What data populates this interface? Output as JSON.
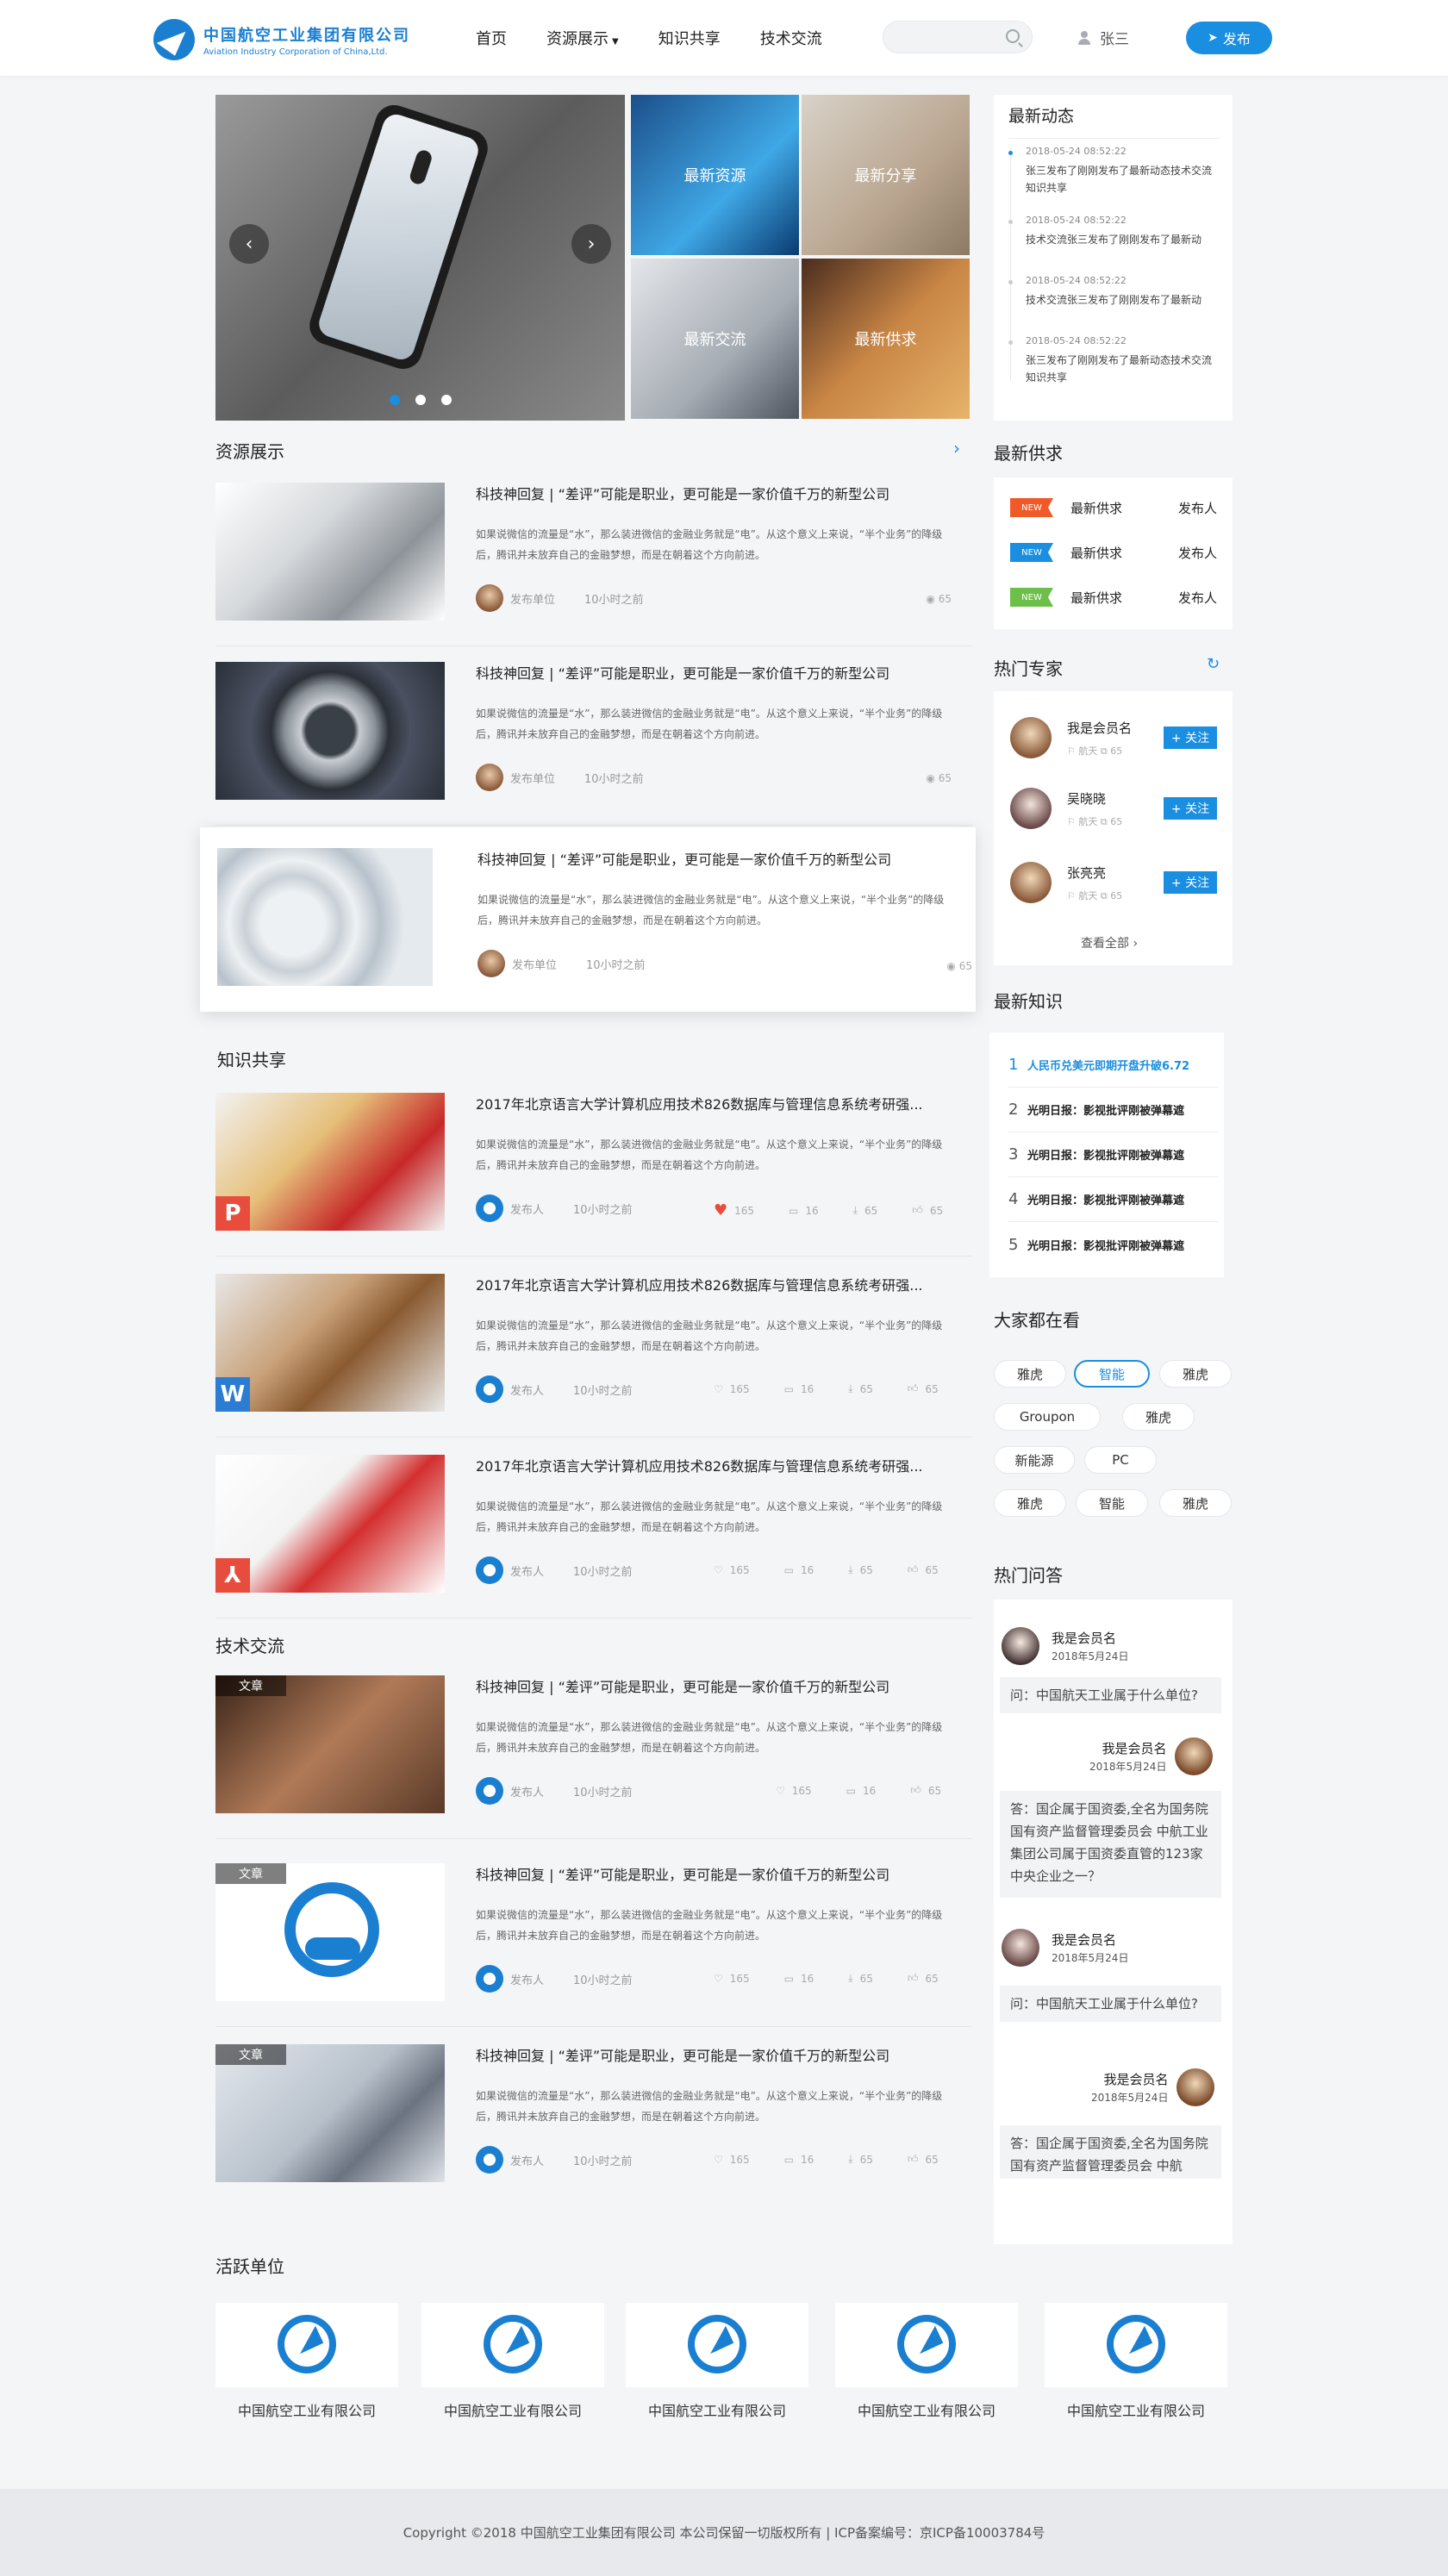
{
  "header": {
    "logo_cn": "中国航空工业集团有限公司",
    "logo_en": "Aviation Industry Corporation of China,Ltd.",
    "nav": [
      "首页",
      "资源展示",
      "知识共享",
      "技术交流"
    ],
    "search_placeholder": "",
    "username": "张三",
    "publish_label": "发布"
  },
  "banner": {
    "tiles": [
      "最新资源",
      "最新分享",
      "最新交流",
      "最新供求"
    ],
    "prev": "‹",
    "next": "›",
    "slides": 3,
    "active_slide": 1
  },
  "sections": {
    "resources": "资源展示",
    "knowledge": "知识共享",
    "tech": "技术交流",
    "units": "活跃单位"
  },
  "resources": [
    {
      "title": "科技神回复 | “差评”可能是职业，更可能是一家价值千万的新型公司",
      "desc": "如果说微信的流量是“水”，那么装进微信的金融业务就是“电”。从这个意义上来说，“半个业务”的降级后，腾讯并未放弃自己的金融梦想，而是在朝着这个方向前进。",
      "author": "发布单位",
      "time": "10小时之前",
      "views": "65"
    },
    {
      "title": "科技神回复 | “差评”可能是职业，更可能是一家价值千万的新型公司",
      "desc": "如果说微信的流量是“水”，那么装进微信的金融业务就是“电”。从这个意义上来说，“半个业务”的降级后，腾讯并未放弃自己的金融梦想，而是在朝着这个方向前进。",
      "author": "发布单位",
      "time": "10小时之前",
      "views": "65"
    },
    {
      "title": "科技神回复 | “差评”可能是职业，更可能是一家价值千万的新型公司",
      "desc": "如果说微信的流量是“水”，那么装进微信的金融业务就是“电”。从这个意义上来说，“半个业务”的降级后，腾讯并未放弃自己的金融梦想，而是在朝着这个方向前进。",
      "author": "发布单位",
      "time": "10小时之前",
      "views": "65"
    }
  ],
  "knowledge": [
    {
      "title": "2017年北京语言大学计算机应用技术826数据库与管理信息系统考研强...",
      "desc": "如果说微信的流量是“水”，那么装进微信的金融业务就是“电”。从这个意义上来说，“半个业务”的降级后，腾讯并未放弃自己的金融梦想，而是在朝着这个方向前进。",
      "author": "发布人",
      "time": "10小时之前",
      "likes": "165",
      "comments": "16",
      "downloads": "65",
      "thumbs": "65",
      "type": "P",
      "type_color": "#e84c3d"
    },
    {
      "title": "2017年北京语言大学计算机应用技术826数据库与管理信息系统考研强...",
      "desc": "如果说微信的流量是“水”，那么装进微信的金融业务就是“电”。从这个意义上来说，“半个业务”的降级后，腾讯并未放弃自己的金融梦想，而是在朝着这个方向前进。",
      "author": "发布人",
      "time": "10小时之前",
      "likes": "165",
      "comments": "16",
      "downloads": "65",
      "thumbs": "65",
      "type": "W",
      "type_color": "#2b7cd3"
    },
    {
      "title": "2017年北京语言大学计算机应用技术826数据库与管理信息系统考研强...",
      "desc": "如果说微信的流量是“水”，那么装进微信的金融业务就是“电”。从这个意义上来说，“半个业务”的降级后，腾讯并未放弃自己的金融梦想，而是在朝着这个方向前进。",
      "author": "发布人",
      "time": "10小时之前",
      "likes": "165",
      "comments": "16",
      "downloads": "65",
      "thumbs": "65",
      "type": "⅄",
      "type_color": "#e84c3d"
    }
  ],
  "tech": [
    {
      "tag": "文章",
      "title": "科技神回复 | “差评”可能是职业，更可能是一家价值千万的新型公司",
      "desc": "如果说微信的流量是“水”，那么装进微信的金融业务就是“电”。从这个意义上来说，“半个业务”的降级后，腾讯并未放弃自己的金融梦想，而是在朝着这个方向前进。",
      "author": "发布人",
      "time": "10小时之前",
      "likes": "165",
      "comments": "16",
      "thumbs": "65"
    },
    {
      "tag": "文章",
      "title": "科技神回复 | “差评”可能是职业，更可能是一家价值千万的新型公司",
      "desc": "如果说微信的流量是“水”，那么装进微信的金融业务就是“电”。从这个意义上来说，“半个业务”的降级后，腾讯并未放弃自己的金融梦想，而是在朝着这个方向前进。",
      "author": "发布人",
      "time": "10小时之前",
      "likes": "165",
      "comments": "16",
      "downloads": "65",
      "thumbs": "65"
    },
    {
      "tag": "文章",
      "title": "科技神回复 | “差评”可能是职业，更可能是一家价值千万的新型公司",
      "desc": "如果说微信的流量是“水”，那么装进微信的金融业务就是“电”。从这个意义上来说，“半个业务”的降级后，腾讯并未放弃自己的金融梦想，而是在朝着这个方向前进。",
      "author": "发布人",
      "time": "10小时之前",
      "likes": "165",
      "comments": "16",
      "downloads": "65",
      "thumbs": "65"
    }
  ],
  "sidebar": {
    "news_title": "最新动态",
    "news": [
      {
        "time": "2018-05-24 08:52:22",
        "text": "张三发布了刚刚发布了最新动态技术交流知识共享"
      },
      {
        "time": "2018-05-24 08:52:22",
        "text": "技术交流张三发布了刚刚发布了最新动"
      },
      {
        "time": "2018-05-24 08:52:22",
        "text": "技术交流张三发布了刚刚发布了最新动"
      },
      {
        "time": "2018-05-24 08:52:22",
        "text": "张三发布了刚刚发布了最新动态技术交流知识共享"
      }
    ],
    "supply_title": "最新供求",
    "supply": [
      {
        "badge": "NEW",
        "color": "#f05a28",
        "name": "最新供求",
        "pub": "发布人"
      },
      {
        "badge": "NEW",
        "color": "#1a8ee0",
        "name": "最新供求",
        "pub": "发布人"
      },
      {
        "badge": "NEW",
        "color": "#6cc04a",
        "name": "最新供求",
        "pub": "发布人"
      }
    ],
    "experts_title": "热门专家",
    "experts": [
      {
        "name": "我是会员名",
        "field": "航天",
        "count": "65",
        "follow": "+ 关注"
      },
      {
        "name": "吴晓晓",
        "field": "航天",
        "count": "65",
        "follow": "+ 关注"
      },
      {
        "name": "张亮亮",
        "field": "航天",
        "count": "65",
        "follow": "+ 关注"
      }
    ],
    "view_all": "查看全部 ›",
    "knowledge_title": "最新知识",
    "knowledge": [
      {
        "num": "1",
        "text": "人民币兑美元即期开盘升破6.72"
      },
      {
        "num": "2",
        "text": "光明日报：影视批评刚被弹幕遮"
      },
      {
        "num": "3",
        "text": "光明日报：影视批评刚被弹幕遮"
      },
      {
        "num": "4",
        "text": "光明日报：影视批评刚被弹幕遮"
      },
      {
        "num": "5",
        "text": "光明日报：影视批评刚被弹幕遮"
      }
    ],
    "watching_title": "大家都在看",
    "tags": [
      "雅虎",
      "智能",
      "雅虎",
      "Groupon",
      "雅虎",
      "新能源",
      "PC",
      "雅虎",
      "智能",
      "雅虎"
    ],
    "qa_title": "热门问答",
    "qa": [
      {
        "name": "我是会员名",
        "date": "2018年5月24日",
        "text": "问：中国航天工业属于什么单位?"
      },
      {
        "name": "我是会员名",
        "date": "2018年5月24日",
        "text": "答：国企属于国资委,全名为国务院国有资产监督管理委员会 中航工业集团公司属于国资委直管的123家中央企业之一？"
      },
      {
        "name": "我是会员名",
        "date": "2018年5月24日",
        "text": "问：中国航天工业属于什么单位?"
      },
      {
        "name": "我是会员名",
        "date": "2018年5月24日",
        "text": "答：国企属于国资委,全名为国务院国有资产监督管理委员会 中航"
      }
    ]
  },
  "units": [
    "中国航空工业有限公司",
    "中国航空工业有限公司",
    "中国航空工业有限公司",
    "中国航空工业有限公司",
    "中国航空工业有限公司"
  ],
  "footer": "Copyright ©2018 中国航空工业集团有限公司 本公司保留一切版权所有 | ICP备案编号：京ICP备10003784号"
}
